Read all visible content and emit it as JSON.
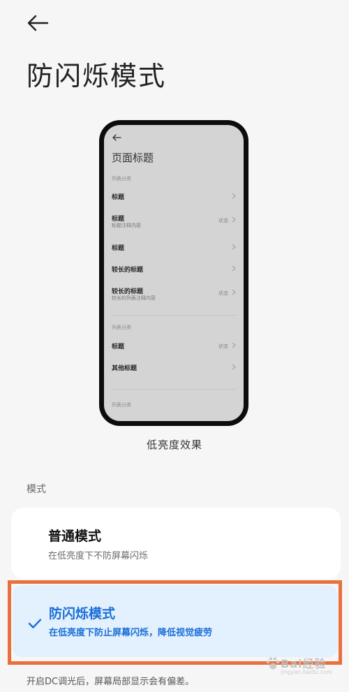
{
  "header": {
    "title": "防闪烁模式"
  },
  "preview": {
    "page_title": "页面标题",
    "categories": [
      "列表分类",
      "列表分类",
      "列表分类"
    ],
    "rows": [
      {
        "title": "标题",
        "subtitle": "",
        "status": ""
      },
      {
        "title": "标题",
        "subtitle": "标题注释内容",
        "status": "状态"
      },
      {
        "title": "标题",
        "subtitle": "",
        "status": ""
      },
      {
        "title": "较长的标题",
        "subtitle": "",
        "status": ""
      },
      {
        "title": "较长的标题",
        "subtitle": "较长的列表注释内容",
        "status": "状态"
      },
      {
        "title": "标题",
        "subtitle": "",
        "status": "状态"
      },
      {
        "title": "其他标题",
        "subtitle": "",
        "status": ""
      }
    ],
    "caption": "低亮度效果"
  },
  "modes": {
    "section_label": "模式",
    "items": [
      {
        "title": "普通模式",
        "description": "在低亮度下不防屏幕闪烁",
        "selected": false
      },
      {
        "title": "防闪烁模式",
        "description": "在低亮度下防止屏幕闪烁，降低视觉疲劳",
        "selected": true
      }
    ]
  },
  "footer": {
    "note": "开启DC调光后，屏幕局部显示会有偏差。"
  },
  "watermark": {
    "text": "Bai经验",
    "sub": "jingyan.baidu.com"
  },
  "colors": {
    "accent": "#1a6fd8",
    "highlight_frame": "#e8703d",
    "selected_bg": "#e3f0fd"
  }
}
